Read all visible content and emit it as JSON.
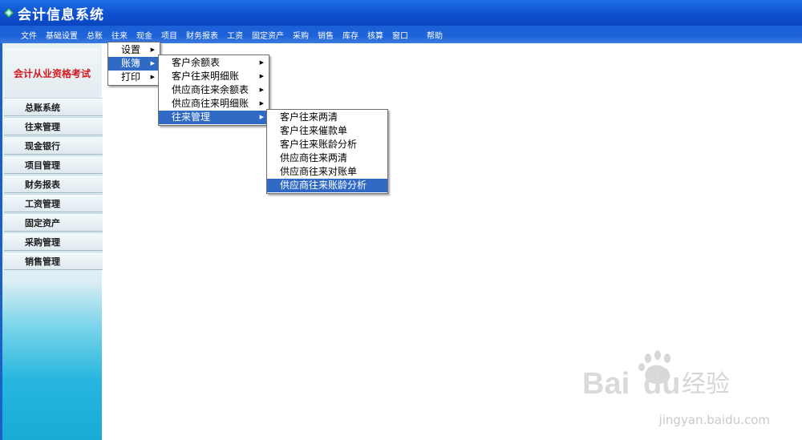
{
  "window": {
    "title": "会计信息系统",
    "icon": "app-icon"
  },
  "menubar": {
    "items": [
      {
        "label": "文件"
      },
      {
        "label": "基础设置"
      },
      {
        "label": "总账"
      },
      {
        "label": "往来"
      },
      {
        "label": "现金"
      },
      {
        "label": "项目"
      },
      {
        "label": "财务报表"
      },
      {
        "label": "工资"
      },
      {
        "label": "固定资产"
      },
      {
        "label": "采购"
      },
      {
        "label": "销售"
      },
      {
        "label": "库存"
      },
      {
        "label": "核算"
      },
      {
        "label": "窗口"
      },
      {
        "label": "帮助"
      }
    ]
  },
  "sidebar": {
    "brand": "会计从业资格考试",
    "items": [
      {
        "label": "总账系统"
      },
      {
        "label": "往来管理"
      },
      {
        "label": "现金银行"
      },
      {
        "label": "项目管理"
      },
      {
        "label": "财务报表"
      },
      {
        "label": "工资管理"
      },
      {
        "label": "固定资产"
      },
      {
        "label": "采购管理"
      },
      {
        "label": "销售管理"
      }
    ]
  },
  "menus": {
    "level1": [
      {
        "label": "设置",
        "submenu": true,
        "selected": false
      },
      {
        "label": "账簿",
        "submenu": true,
        "selected": true
      },
      {
        "label": "打印",
        "submenu": true,
        "selected": false
      }
    ],
    "level2": [
      {
        "label": "客户余额表",
        "submenu": true,
        "selected": false
      },
      {
        "label": "客户往来明细账",
        "submenu": true,
        "selected": false
      },
      {
        "label": "供应商往来余额表",
        "submenu": true,
        "selected": false
      },
      {
        "label": "供应商往来明细账",
        "submenu": true,
        "selected": false
      },
      {
        "label": "往来管理",
        "submenu": true,
        "selected": true
      }
    ],
    "level3": [
      {
        "label": "客户往来两清",
        "selected": false
      },
      {
        "label": "客户往来催款单",
        "selected": false
      },
      {
        "label": "客户往来账龄分析",
        "selected": false
      },
      {
        "label": "供应商往来两清",
        "selected": false
      },
      {
        "label": "供应商往来对账单",
        "selected": false
      },
      {
        "label": "供应商往来账龄分析",
        "selected": true
      }
    ]
  },
  "watermark": {
    "logo_text": "Baidu经验",
    "url": "jingyan.baidu.com"
  },
  "colors": {
    "titlebar": "#0f52d3",
    "menu_selected": "#316ac5",
    "brand_text": "#d4181e",
    "sidebar_bottom": "#19aad6"
  }
}
